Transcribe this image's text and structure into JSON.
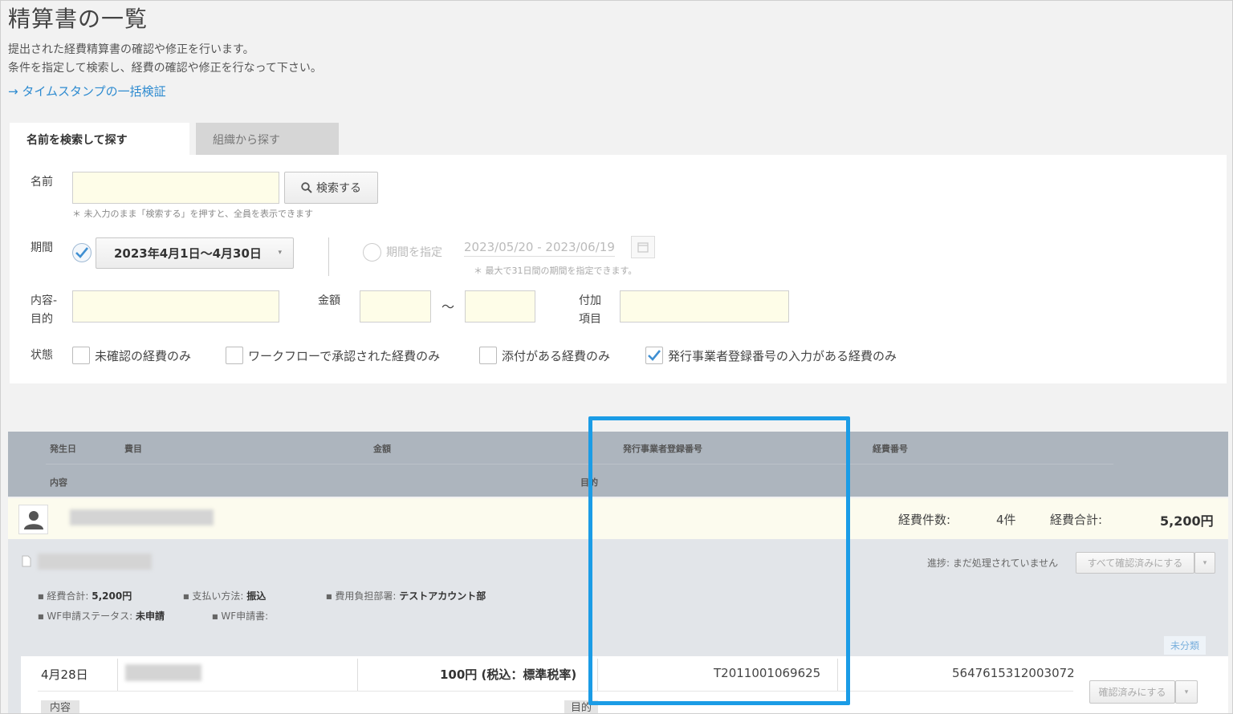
{
  "page": {
    "title": "精算書の一覧",
    "desc_line1": "提出された経費精算書の確認や修正を行います。",
    "desc_line2": "条件を指定して検索し、経費の確認や修正を行なって下さい。",
    "timestamp_link": "→ タイムスタンプの一括検証"
  },
  "tabs": {
    "search_by_name": "名前を検索して探す",
    "search_by_org": "組織から探す"
  },
  "form": {
    "name_label": "名前",
    "search_button": "検索する",
    "name_hint": "＊ 未入力のまま「検索する」を押すと、全員を表示できます",
    "period_label": "期間",
    "period_select": "2023年4月1日～4月30日",
    "period_custom_label": "期間を指定",
    "period_custom_value": "2023/05/20 - 2023/06/19",
    "period_hint": "＊ 最大で31日間の期間を指定できます。",
    "content_label_1": "内容-",
    "content_label_2": "目的",
    "amount_label": "金額",
    "amount_tilde": "～",
    "extra_label_1": "付加",
    "extra_label_2": "項目",
    "status_label": "状態",
    "cb_unconfirmed": "未確認の経費のみ",
    "cb_workflow": "ワークフローで承認された経費のみ",
    "cb_attachment": "添付がある経費のみ",
    "cb_invoice_number": "発行事業者登録番号の入力がある経費のみ"
  },
  "checkboxes": {
    "period_preset_checked": true,
    "unconfirmed_checked": false,
    "workflow_checked": false,
    "attachment_checked": false,
    "invoice_number_checked": true
  },
  "table_header": {
    "date": "発生日",
    "category": "費目",
    "amount": "金額",
    "invoice_number": "発行事業者登録番号",
    "expense_number": "経費番号",
    "content": "内容",
    "purpose": "目的"
  },
  "user_row": {
    "count_label": "経費件数:",
    "count_value": "4件",
    "total_label": "経費合計:",
    "total_value": "5,200円"
  },
  "report": {
    "progress": "進捗: まだ処理されていません",
    "confirm_all_button": "すべて確認済みにする",
    "total_label": "経費合計:",
    "total_value": "5,200円",
    "payment_label": "支払い方法:",
    "payment_value": "振込",
    "dept_label": "費用負担部署:",
    "dept_value": "テストアカウント部",
    "wf_status_label": "WF申請ステータス:",
    "wf_status_value": "未申請",
    "wf_doc_label": "WF申請書:",
    "uncategorized_badge": "未分類"
  },
  "detail": {
    "date": "4月28日",
    "amount": "100円 (税込：標準税率)",
    "invoice_number": "T2011001069625",
    "expense_number": "5647615312003072",
    "confirm_button": "確認済みにする",
    "content_label": "内容",
    "purpose_label": "目的"
  },
  "colors": {
    "highlight": "#1b9ce6",
    "link": "#2e8bd0",
    "header_bg": "#adb5be",
    "input_bg": "#fefde8"
  }
}
